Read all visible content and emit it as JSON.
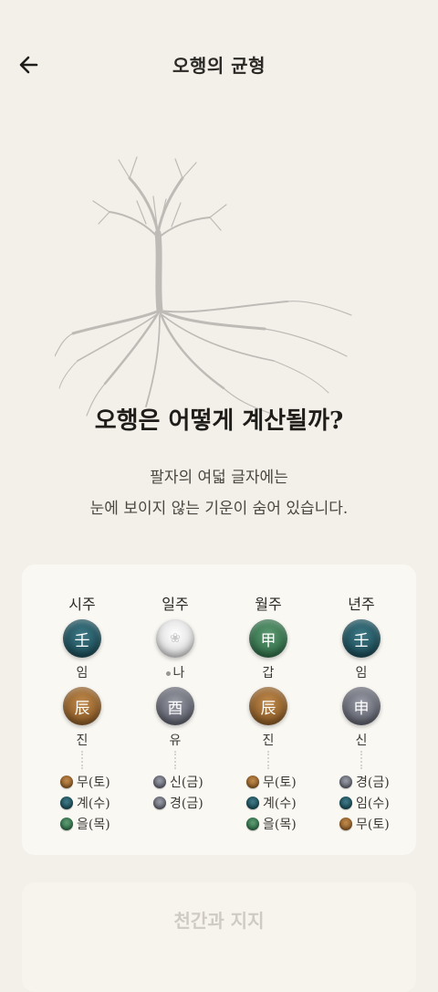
{
  "header": {
    "title": "오행의 균형"
  },
  "intro": {
    "headline": "오행은 어떻게 계산될까?",
    "line1": "팔자의 여덟 글자에는",
    "line2": "눈에 보이지 않는 기운이 숨어 있습니다."
  },
  "pillars": [
    {
      "label": "시주",
      "stem": {
        "char": "壬",
        "reading": "임",
        "color": "teal"
      },
      "branch": {
        "char": "辰",
        "reading": "진",
        "color": "brown"
      },
      "hidden": [
        {
          "text": "무(토)",
          "color": "brown"
        },
        {
          "text": "계(수)",
          "color": "teal"
        },
        {
          "text": "을(목)",
          "color": "green"
        }
      ]
    },
    {
      "label": "일주",
      "stem": {
        "char": "",
        "reading": "나",
        "color": "white"
      },
      "branch": {
        "char": "酉",
        "reading": "유",
        "color": "gray"
      },
      "hidden": [
        {
          "text": "신(금)",
          "color": "gray"
        },
        {
          "text": "경(금)",
          "color": "gray"
        }
      ]
    },
    {
      "label": "월주",
      "stem": {
        "char": "甲",
        "reading": "갑",
        "color": "green"
      },
      "branch": {
        "char": "辰",
        "reading": "진",
        "color": "brown"
      },
      "hidden": [
        {
          "text": "무(토)",
          "color": "brown"
        },
        {
          "text": "계(수)",
          "color": "teal"
        },
        {
          "text": "을(목)",
          "color": "green"
        }
      ]
    },
    {
      "label": "년주",
      "stem": {
        "char": "壬",
        "reading": "임",
        "color": "teal"
      },
      "branch": {
        "char": "申",
        "reading": "신",
        "color": "gray"
      },
      "hidden": [
        {
          "text": "경(금)",
          "color": "gray"
        },
        {
          "text": "임(수)",
          "color": "teal"
        },
        {
          "text": "무(토)",
          "color": "brown"
        }
      ]
    }
  ],
  "next_section": {
    "title": "천간과 지지"
  }
}
